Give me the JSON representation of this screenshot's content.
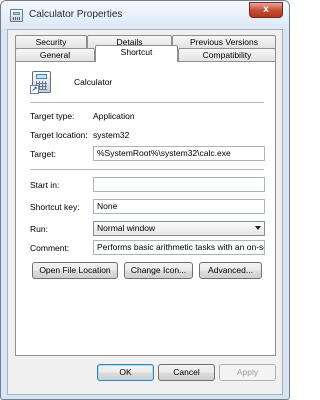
{
  "window": {
    "title": "Calculator Properties"
  },
  "titlebar": {
    "close_label": "x"
  },
  "tabs": {
    "row1": [
      "Security",
      "Details",
      "Previous Versions"
    ],
    "row2": [
      "General",
      "Shortcut",
      "Compatibility"
    ],
    "active": "Shortcut"
  },
  "shortcut": {
    "name": "Calculator",
    "target_type_label": "Target type:",
    "target_type_value": "Application",
    "target_location_label": "Target location:",
    "target_location_value": "system32",
    "target_label": "Target:",
    "target_value": "%SystemRoot%\\system32\\calc.exe",
    "start_in_label": "Start in:",
    "start_in_value": "",
    "shortcut_key_label": "Shortcut key:",
    "shortcut_key_value": "None",
    "run_label": "Run:",
    "run_value": "Normal window",
    "comment_label": "Comment:",
    "comment_value": "Performs basic arithmetic tasks with an on-screen"
  },
  "actions": {
    "open_file_location": "Open File Location",
    "change_icon": "Change Icon...",
    "advanced": "Advanced..."
  },
  "footer": {
    "ok": "OK",
    "cancel": "Cancel",
    "apply": "Apply"
  }
}
